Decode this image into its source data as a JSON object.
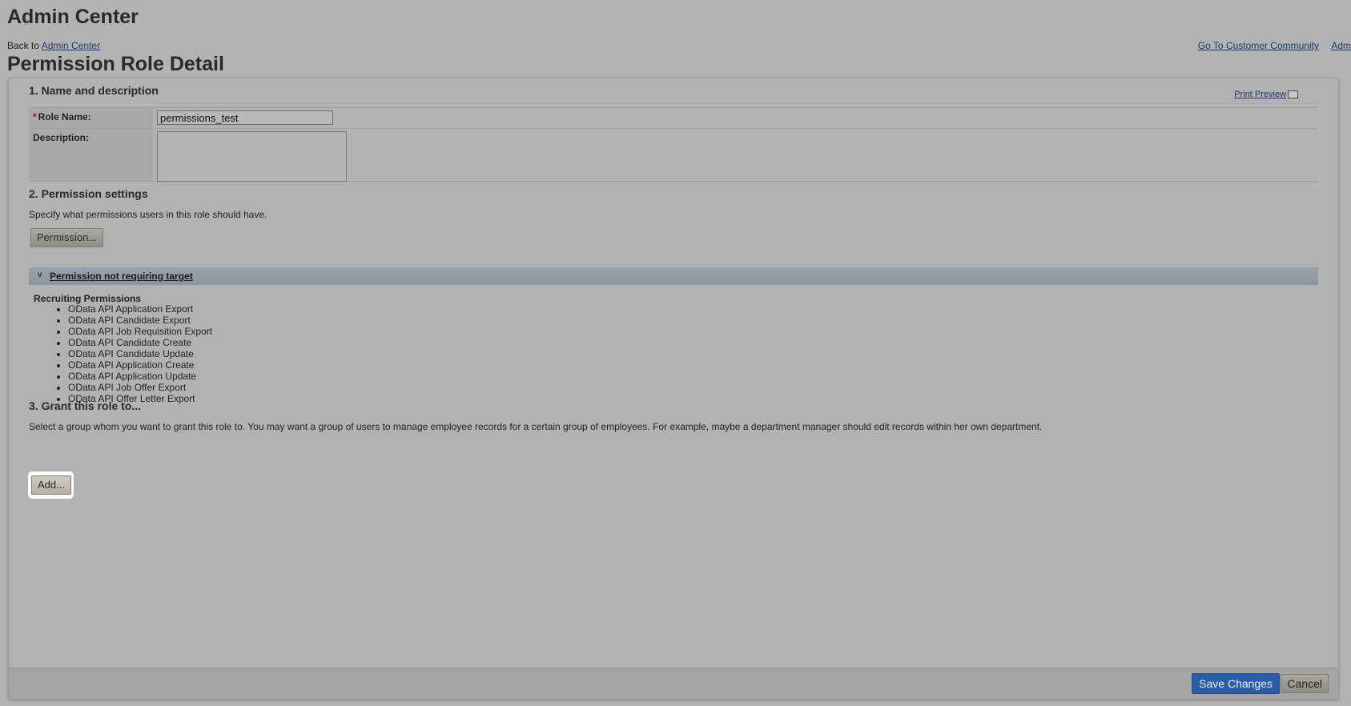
{
  "header": {
    "app_title": "Admin Center",
    "back_prefix": "Back to ",
    "back_link": "Admin Center",
    "links": [
      "Go To Customer Community",
      "Adm"
    ],
    "page_title": "Permission Role Detail"
  },
  "section1": {
    "title": "1. Name and description",
    "print_preview": "Print Preview",
    "role_name_required": "*",
    "role_name_label": "Role Name:",
    "role_name_value": "permissions_test",
    "description_label": "Description:",
    "description_value": ""
  },
  "section2": {
    "title": "2. Permission settings",
    "help_text": "Specify what permissions users in this role should have.",
    "permission_button": "Permission...",
    "bar_chevron": "v",
    "bar_label": "Permission not requiring target",
    "group_title": "Recruiting Permissions",
    "permissions": [
      "OData API Application Export",
      "OData API Candidate Export",
      "OData API Job Requisition Export",
      "OData API Candidate Create",
      "OData API Candidate Update",
      "OData API Application Create",
      "OData API Application Update",
      "OData API Job Offer Export",
      "OData API Offer Letter Export"
    ]
  },
  "section3": {
    "title": "3. Grant this role to...",
    "help_text": "Select a group whom you want to grant this role to. You may want a group of users to manage employee records for a certain group of employees. For example, maybe a department manager should edit records within her own department.",
    "add_button": "Add..."
  },
  "footer": {
    "save_button": "Save Changes",
    "cancel_button": "Cancel"
  },
  "colors": {
    "background": "#b3b3b3",
    "save_button": "#2a5ca8",
    "link": "#1c3c63"
  }
}
